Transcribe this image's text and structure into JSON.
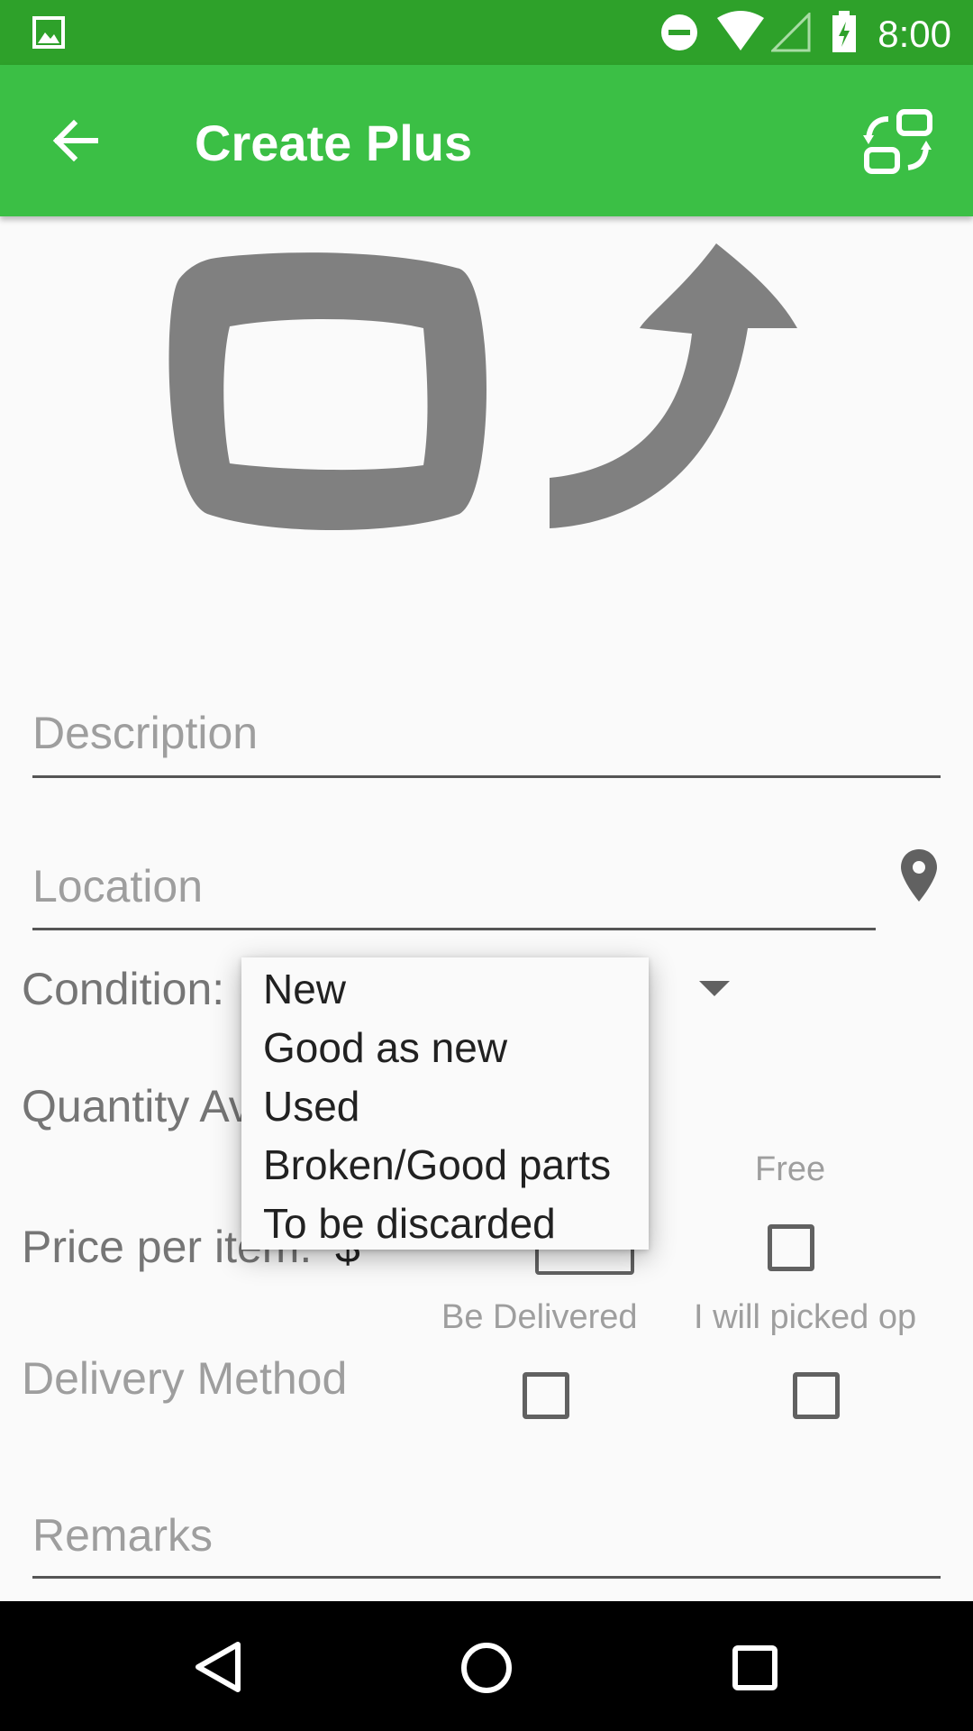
{
  "status_bar": {
    "time": "8:00",
    "icons": [
      "gallery-icon",
      "do-not-disturb-icon",
      "wifi-icon",
      "signal-icon",
      "battery-icon"
    ]
  },
  "app_bar": {
    "title": "Create Plus",
    "back_icon": "arrow-back-icon",
    "action_icon": "swap-icon"
  },
  "form": {
    "description_placeholder": "Description",
    "location_placeholder": "Location",
    "condition_label": "Condition:",
    "quantity_label": "Quantity Av",
    "price_label": "Price per item:",
    "currency": "$",
    "free_label": "Free",
    "be_delivered_label": "Be Delivered",
    "pick_up_label": "I will picked op",
    "delivery_method_label": "Delivery Method",
    "remarks_placeholder": "Remarks"
  },
  "condition_dropdown": {
    "options": [
      "New",
      "Good as new",
      "Used",
      "Broken/Good parts",
      "To be discarded"
    ]
  },
  "colors": {
    "status_bar": "#2ea12a",
    "app_bar": "#3bbf45",
    "icon_gray": "#808080"
  }
}
